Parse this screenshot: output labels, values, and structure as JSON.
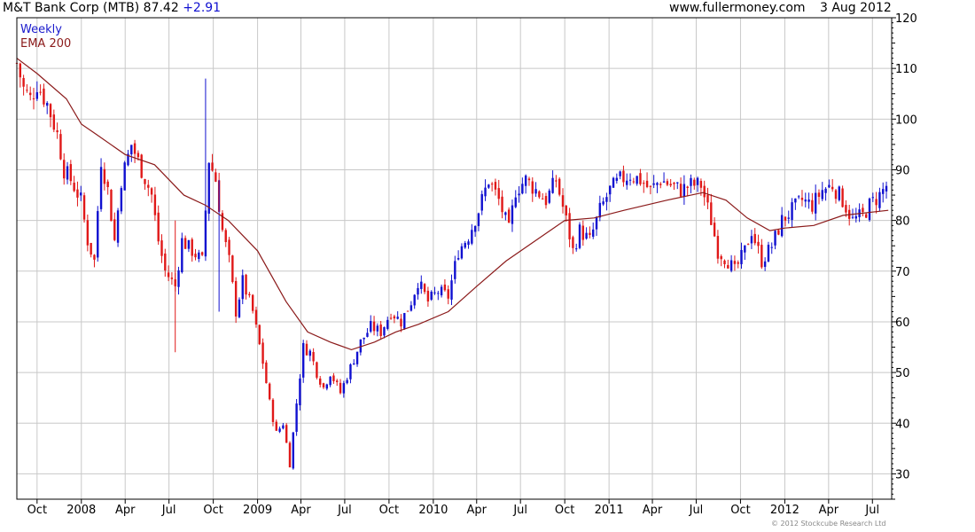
{
  "header": {
    "symbol_text": "M&T Bank Corp (MTB) 87.42",
    "change": "+2.91",
    "site": "www.fullermoney.com",
    "date": "3 Aug 2012"
  },
  "copyright": "© 2012 Stockcube Research Ltd",
  "colors": {
    "up": "#1010d0",
    "down": "#e01818",
    "ema": "#8b1a1a",
    "grid": "#c8c8c8"
  },
  "chart_data": {
    "type": "candlestick",
    "title": "M&T Bank Corp (MTB)",
    "legend": [
      {
        "label": "Weekly",
        "color": "#1a1acc"
      },
      {
        "label": "EMA 200",
        "color": "#8b1a1a"
      }
    ],
    "y_axis": {
      "position": "right",
      "ylim": [
        25,
        120
      ],
      "ticks": [
        30,
        40,
        50,
        60,
        70,
        80,
        90,
        100,
        110,
        120
      ]
    },
    "x_axis": {
      "range": [
        "2007-08-20",
        "2012-08-10"
      ],
      "ticks": [
        {
          "date": "2007-10-01",
          "label": "Oct"
        },
        {
          "date": "2008-01-01",
          "label": "2008"
        },
        {
          "date": "2008-04-01",
          "label": "Apr"
        },
        {
          "date": "2008-07-01",
          "label": "Jul"
        },
        {
          "date": "2008-10-01",
          "label": "Oct"
        },
        {
          "date": "2009-01-01",
          "label": "2009"
        },
        {
          "date": "2009-04-01",
          "label": "Apr"
        },
        {
          "date": "2009-07-01",
          "label": "Jul"
        },
        {
          "date": "2009-10-01",
          "label": "Oct"
        },
        {
          "date": "2010-01-01",
          "label": "2010"
        },
        {
          "date": "2010-04-01",
          "label": "Apr"
        },
        {
          "date": "2010-07-01",
          "label": "Jul"
        },
        {
          "date": "2010-10-01",
          "label": "Oct"
        },
        {
          "date": "2011-01-01",
          "label": "2011"
        },
        {
          "date": "2011-04-01",
          "label": "Apr"
        },
        {
          "date": "2011-07-01",
          "label": "Jul"
        },
        {
          "date": "2011-10-01",
          "label": "Oct"
        },
        {
          "date": "2012-01-01",
          "label": "2012"
        },
        {
          "date": "2012-04-01",
          "label": "Apr"
        },
        {
          "date": "2012-07-01",
          "label": "Jul"
        }
      ]
    },
    "price_path": [
      [
        "2007-08-20",
        111
      ],
      [
        "2007-09-03",
        106
      ],
      [
        "2007-09-17",
        104
      ],
      [
        "2007-10-01",
        107
      ],
      [
        "2007-10-22",
        103
      ],
      [
        "2007-11-12",
        97
      ],
      [
        "2007-11-26",
        90
      ],
      [
        "2007-12-10",
        88
      ],
      [
        "2007-12-31",
        84
      ],
      [
        "2008-01-14",
        76
      ],
      [
        "2008-01-28",
        72
      ],
      [
        "2008-02-11",
        92
      ],
      [
        "2008-02-25",
        86
      ],
      [
        "2008-03-10",
        76
      ],
      [
        "2008-03-24",
        88
      ],
      [
        "2008-04-14",
        95
      ],
      [
        "2008-05-05",
        90
      ],
      [
        "2008-05-26",
        85
      ],
      [
        "2008-06-09",
        76
      ],
      [
        "2008-06-23",
        70
      ],
      [
        "2008-07-14",
        67
      ],
      [
        "2008-07-28",
        76
      ],
      [
        "2008-08-18",
        74
      ],
      [
        "2008-09-08",
        72
      ],
      [
        "2008-09-22",
        92
      ],
      [
        "2008-10-06",
        88
      ],
      [
        "2008-10-20",
        78
      ],
      [
        "2008-11-03",
        72
      ],
      [
        "2008-11-17",
        62
      ],
      [
        "2008-12-01",
        68
      ],
      [
        "2008-12-22",
        62
      ],
      [
        "2009-01-12",
        52
      ],
      [
        "2009-01-26",
        44
      ],
      [
        "2009-02-09",
        38
      ],
      [
        "2009-02-23",
        40
      ],
      [
        "2009-03-09",
        32
      ],
      [
        "2009-03-23",
        44
      ],
      [
        "2009-04-06",
        55
      ],
      [
        "2009-04-20",
        54
      ],
      [
        "2009-05-04",
        50
      ],
      [
        "2009-05-18",
        47
      ],
      [
        "2009-06-01",
        50
      ],
      [
        "2009-06-22",
        46
      ],
      [
        "2009-07-13",
        51
      ],
      [
        "2009-08-03",
        56
      ],
      [
        "2009-08-24",
        59
      ],
      [
        "2009-09-14",
        58
      ],
      [
        "2009-10-05",
        62
      ],
      [
        "2009-10-26",
        60
      ],
      [
        "2009-11-16",
        64
      ],
      [
        "2009-11-30",
        68
      ],
      [
        "2009-12-21",
        64
      ],
      [
        "2010-01-11",
        66
      ],
      [
        "2010-02-01",
        65
      ],
      [
        "2010-02-22",
        74
      ],
      [
        "2010-03-15",
        77
      ],
      [
        "2010-04-05",
        82
      ],
      [
        "2010-04-26",
        88
      ],
      [
        "2010-05-17",
        84
      ],
      [
        "2010-06-07",
        78
      ],
      [
        "2010-06-21",
        86
      ],
      [
        "2010-07-12",
        88
      ],
      [
        "2010-08-02",
        86
      ],
      [
        "2010-08-23",
        84
      ],
      [
        "2010-09-13",
        88
      ],
      [
        "2010-10-04",
        80
      ],
      [
        "2010-10-18",
        74
      ],
      [
        "2010-11-01",
        78
      ],
      [
        "2010-11-22",
        76
      ],
      [
        "2010-12-13",
        82
      ],
      [
        "2011-01-03",
        86
      ],
      [
        "2011-01-24",
        88
      ],
      [
        "2011-02-14",
        89
      ],
      [
        "2011-03-07",
        88
      ],
      [
        "2011-03-28",
        86
      ],
      [
        "2011-04-18",
        88
      ],
      [
        "2011-05-09",
        87
      ],
      [
        "2011-05-30",
        86
      ],
      [
        "2011-06-20",
        87
      ],
      [
        "2011-07-11",
        87
      ],
      [
        "2011-08-01",
        80
      ],
      [
        "2011-08-15",
        74
      ],
      [
        "2011-09-05",
        72
      ],
      [
        "2011-09-19",
        70
      ],
      [
        "2011-10-10",
        74
      ],
      [
        "2011-10-24",
        78
      ],
      [
        "2011-11-14",
        72
      ],
      [
        "2011-12-05",
        75
      ],
      [
        "2011-12-26",
        80
      ],
      [
        "2012-01-16",
        82
      ],
      [
        "2012-02-06",
        84
      ],
      [
        "2012-02-27",
        83
      ],
      [
        "2012-03-19",
        86
      ],
      [
        "2012-04-09",
        87
      ],
      [
        "2012-04-30",
        84
      ],
      [
        "2012-05-21",
        80
      ],
      [
        "2012-06-11",
        81
      ],
      [
        "2012-06-25",
        83
      ],
      [
        "2012-07-16",
        85
      ],
      [
        "2012-08-03",
        87.4
      ]
    ],
    "spikes": [
      [
        "2008-09-15",
        108,
        76
      ],
      [
        "2008-07-14",
        80,
        54
      ],
      [
        "2008-10-13",
        88,
        62
      ]
    ],
    "ema_200": [
      [
        "2007-08-20",
        112
      ],
      [
        "2007-10-01",
        109
      ],
      [
        "2007-12-01",
        104
      ],
      [
        "2008-01-01",
        99
      ],
      [
        "2008-02-01",
        97
      ],
      [
        "2008-04-01",
        93
      ],
      [
        "2008-06-01",
        91
      ],
      [
        "2008-08-01",
        85
      ],
      [
        "2008-09-15",
        83
      ],
      [
        "2008-11-01",
        80
      ],
      [
        "2009-01-01",
        74
      ],
      [
        "2009-03-01",
        64
      ],
      [
        "2009-04-15",
        58
      ],
      [
        "2009-06-01",
        56
      ],
      [
        "2009-07-15",
        54.5
      ],
      [
        "2009-09-01",
        56
      ],
      [
        "2009-10-15",
        58
      ],
      [
        "2009-12-01",
        59.5
      ],
      [
        "2010-02-01",
        62
      ],
      [
        "2010-04-01",
        67
      ],
      [
        "2010-06-01",
        72
      ],
      [
        "2010-08-01",
        76
      ],
      [
        "2010-10-01",
        80
      ],
      [
        "2010-12-01",
        80.5
      ],
      [
        "2011-02-01",
        82
      ],
      [
        "2011-05-01",
        84
      ],
      [
        "2011-07-15",
        85.5
      ],
      [
        "2011-09-01",
        84
      ],
      [
        "2011-10-15",
        80.5
      ],
      [
        "2011-12-01",
        78
      ],
      [
        "2012-01-01",
        78.5
      ],
      [
        "2012-03-01",
        79
      ],
      [
        "2012-05-01",
        81
      ],
      [
        "2012-08-03",
        82
      ]
    ]
  }
}
